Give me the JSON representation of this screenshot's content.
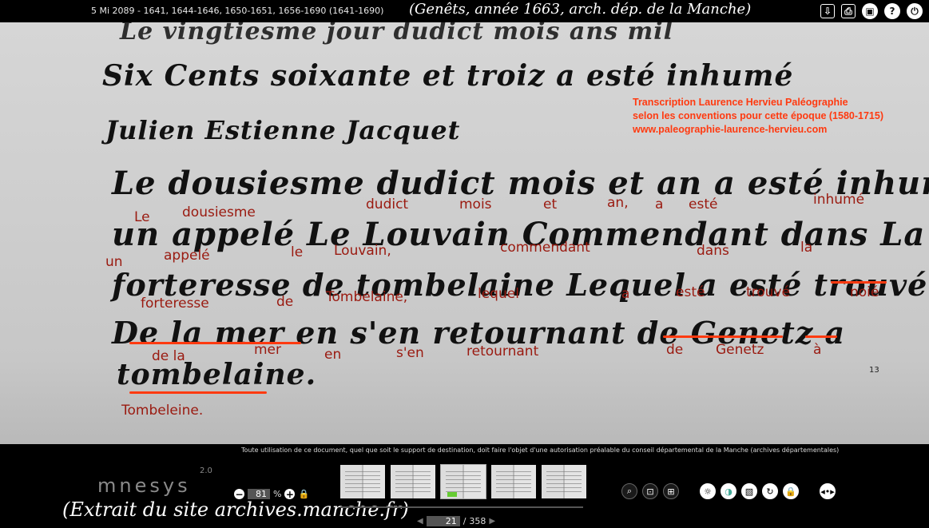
{
  "header": {
    "doc_title": "5 Mi 2089 - 1641, 1644-1646, 1650-1651, 1656-1690 (1641-1690)",
    "handwritten_title": "(Genêts, année 1663, arch. dép. de la Manche)",
    "icons": [
      "download-icon",
      "print-icon",
      "fullscreen-icon",
      "help-icon",
      "power-icon"
    ],
    "icon_glyphs": {
      "download": "⇩",
      "print": "⎙",
      "fullscreen": "▣",
      "help": "?",
      "power": "⏻"
    }
  },
  "credit": {
    "line1": "Transcription Laurence Hervieu Paléographie",
    "line2": "selon les conventions pour cette époque (1580-1715)",
    "line3": "www.paleographie-laurence-hervieu.com"
  },
  "transcription": {
    "l1": [
      "Le",
      "dousiesme",
      "dudict",
      "mois",
      "et",
      "an,",
      "a",
      "esté",
      "inhumé"
    ],
    "l2": [
      "un",
      "appelé",
      "le",
      "Louvain,",
      "commendant",
      "dans",
      "la"
    ],
    "l3": [
      "forteresse",
      "de",
      "Tombelaine,",
      "lequel",
      "a",
      "esté",
      "trouvé",
      "noié"
    ],
    "l4": [
      "de la",
      "mer",
      "en",
      "s'en",
      "retournant",
      "de",
      "Genetz",
      "à"
    ],
    "l5": [
      "Tombeleine."
    ]
  },
  "page_marker": "13",
  "notice": "Toute utilisation de ce document, quel que soit le support de destination, doit faire l'objet d'une autorisation préalable du conseil départemental de la Manche (archives départementales)",
  "footer": {
    "logo": "mnesys",
    "logo_version": "2.0",
    "handwritten_source": "(Extrait du site archives.manche.fr)",
    "zoom_value": "81",
    "zoom_unit": "%",
    "zoom_minus": "−",
    "zoom_plus": "+",
    "page_current": "21",
    "page_separator": "/",
    "page_total": "358",
    "prev_arrow": "◀",
    "next_arrow": "▶",
    "tool_glyphs": [
      "⌕",
      "⊡",
      "⊞",
      "☼",
      "◑",
      "▧",
      "↻",
      "🔒",
      "◂•▸"
    ]
  }
}
